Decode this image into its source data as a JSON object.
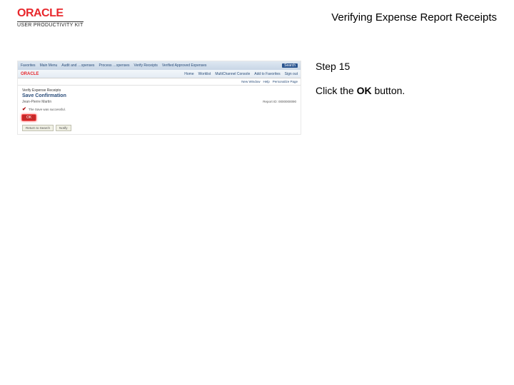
{
  "header": {
    "brand_name": "ORACLE",
    "brand_subtitle": "USER PRODUCTIVITY KIT",
    "title": "Verifying Expense Report Receipts"
  },
  "instructions": {
    "step_label": "Step 15",
    "text_before": "Click the ",
    "bold": "OK",
    "text_after": " button."
  },
  "screenshot": {
    "topbar_left": [
      "Favorites",
      "Main Menu",
      "Audit and …xpenses",
      "Process …xpenses",
      "Verify Receipts",
      "Verified Approved Expenses"
    ],
    "topbar_search": "Search",
    "row2_logo": "ORACLE",
    "row2_links": [
      "Home",
      "Worklist",
      "MultiChannel Console",
      "Add to Favorites",
      "Sign out"
    ],
    "row3_links": [
      "New Window",
      "Help",
      "Personalize Page"
    ],
    "h1": "Verify Expense Receipts",
    "h2": "Save Confirmation",
    "sub": "Jean-Pierre Martin",
    "req": "Report ID: 0000000090",
    "msg": "The Save was successful.",
    "ok_label": "OK",
    "footer_btn1": "Return to Search",
    "footer_btn2": "Notify"
  }
}
